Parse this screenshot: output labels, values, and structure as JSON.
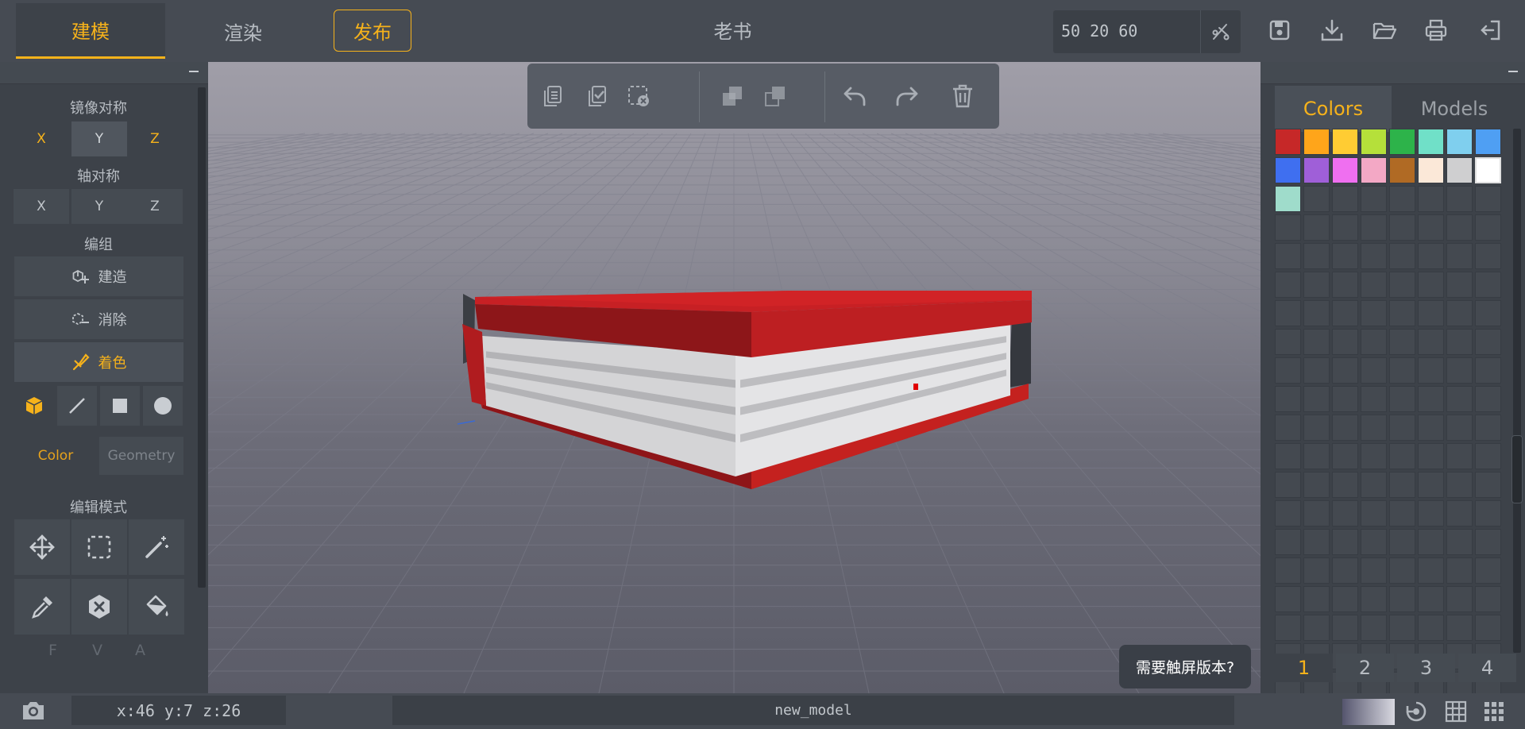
{
  "app": {
    "tabs": {
      "model": "建模",
      "render": "渲染",
      "publish": "发布"
    },
    "title": "老书",
    "dimensions_input": "50 20 60",
    "accent_color": "#f6b21b"
  },
  "left_panel": {
    "mirror": {
      "label": "镜像对称",
      "axes": [
        "X",
        "Y",
        "Z"
      ]
    },
    "axis_sym": {
      "label": "轴对称",
      "axes": [
        "X",
        "Y",
        "Z"
      ]
    },
    "edit": {
      "label": "编组",
      "build": "建造",
      "erase": "消除",
      "paint": "着色"
    },
    "subtabs": {
      "color": "Color",
      "geometry": "Geometry"
    },
    "edit_mode": {
      "label": "编辑模式"
    },
    "fva": [
      "F",
      "V",
      "A"
    ]
  },
  "viewport": {
    "touch_prompt": "需要触屏版本?"
  },
  "right_panel": {
    "tabs": {
      "colors": "Colors",
      "models": "Models"
    },
    "swatches": [
      "#c62828",
      "#ffa51a",
      "#ffcc33",
      "#b5e03a",
      "#2db34a",
      "#70e0c8",
      "#7fcfee",
      "#4f9ff3",
      "#3f6ff0",
      "#9f5fd8",
      "#ef6ff0",
      "#f3a8c5",
      "#b06a24",
      "#fbe8d8",
      "#cfcfd0",
      "#ffffff",
      "#9fdccb"
    ],
    "pages": [
      "1",
      "2",
      "3",
      "4"
    ]
  },
  "bottom_bar": {
    "coords": "x:46 y:7 z:26",
    "filename": "new_model"
  }
}
